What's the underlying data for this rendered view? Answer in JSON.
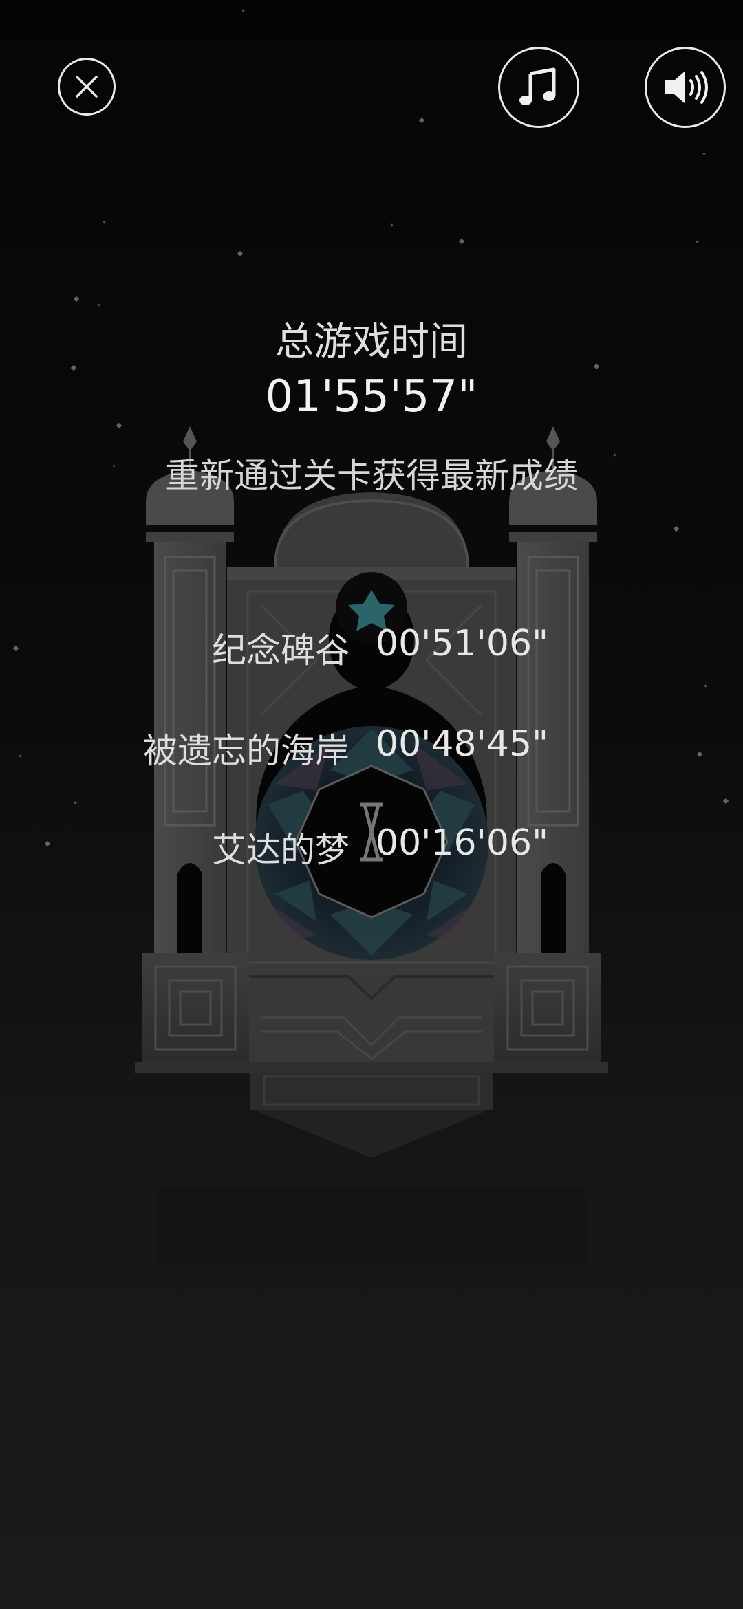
{
  "header": {
    "close_icon": "close-icon",
    "music_icon": "music-note-icon",
    "sound_icon": "speaker-icon"
  },
  "summary": {
    "total_label": "总游戏时间",
    "total_time": "01'55'57\"",
    "hint": "重新通过关卡获得最新成绩"
  },
  "levels": [
    {
      "name": "纪念碑谷",
      "time": "00'51'06\""
    },
    {
      "name": "被遗忘的海岸",
      "time": "00'48'45\""
    },
    {
      "name": "艾达的梦",
      "time": "00'16'06\""
    }
  ],
  "colors": {
    "background": "#0b0b0b",
    "monument": "#3a3a3a",
    "text": "#e6e6e6",
    "gem_accent": "#2f6f74"
  }
}
